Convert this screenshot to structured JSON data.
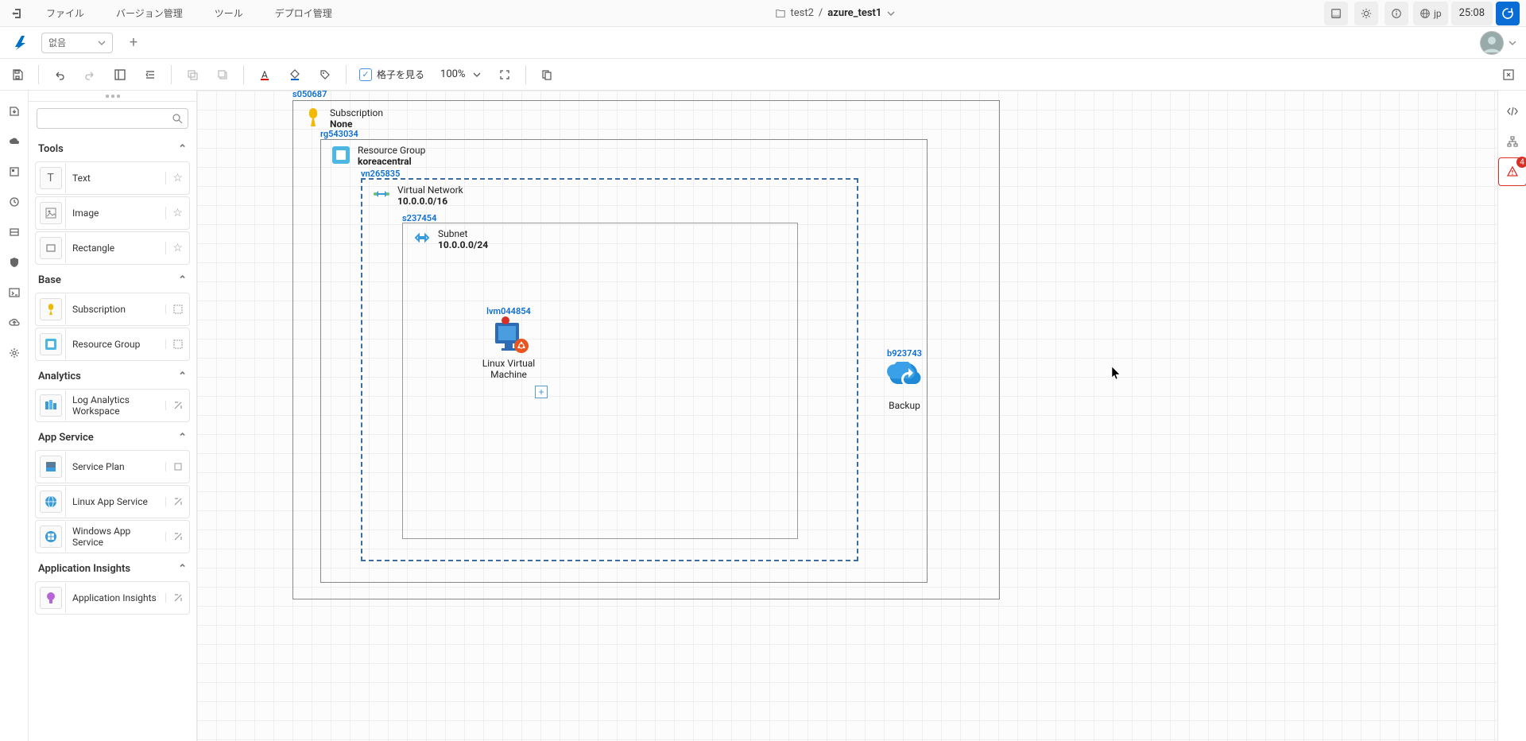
{
  "menubar": {
    "file": "ファイル",
    "version": "バージョン管理",
    "tools": "ツール",
    "deploy": "デプロイ管理"
  },
  "breadcrumb": {
    "folder": "test2",
    "file": "azure_test1"
  },
  "header_right": {
    "language": "jp",
    "time": "25:08"
  },
  "subheader": {
    "dropdown": "없음"
  },
  "toolbar": {
    "grid_label": "格子を見る",
    "zoom": "100%"
  },
  "palette": {
    "sections": {
      "tools": {
        "title": "Tools",
        "items": [
          "Text",
          "Image",
          "Rectangle"
        ]
      },
      "base": {
        "title": "Base",
        "items": [
          "Subscription",
          "Resource Group"
        ]
      },
      "analytics": {
        "title": "Analytics",
        "items": [
          "Log Analytics Workspace"
        ]
      },
      "appservice": {
        "title": "App Service",
        "items": [
          "Service Plan",
          "Linux App Service",
          "Windows App Service"
        ]
      },
      "appinsights": {
        "title": "Application Insights",
        "items": [
          "Application Insights"
        ]
      }
    }
  },
  "diagram": {
    "subscription": {
      "id": "s050687",
      "title": "Subscription",
      "value": "None"
    },
    "resource_group": {
      "id": "rg543034",
      "title": "Resource Group",
      "value": "koreacentral"
    },
    "virtual_network": {
      "id": "vn265835",
      "title": "Virtual Network",
      "value": "10.0.0.0/16"
    },
    "subnet": {
      "id": "s237454",
      "title": "Subnet",
      "value": "10.0.0.0/24"
    },
    "vm": {
      "id": "lvm044854",
      "title": "Linux Virtual Machine"
    },
    "backup": {
      "id": "b923743",
      "title": "Backup"
    }
  },
  "right_rail": {
    "warning_count": "4"
  }
}
